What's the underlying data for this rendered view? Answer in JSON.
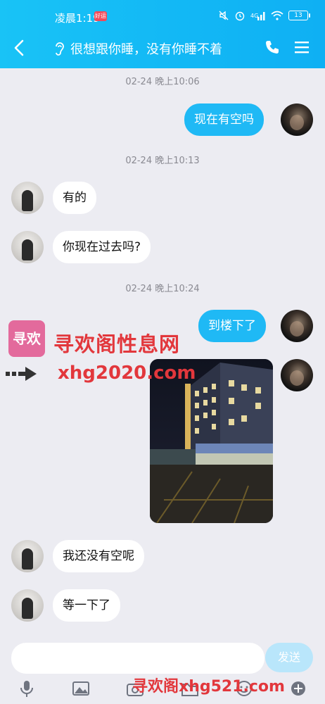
{
  "status_bar": {
    "time": "凌晨1:19",
    "badge": "好运",
    "battery": "13"
  },
  "header": {
    "title": "很想跟你睡，没有你睡不着"
  },
  "messages": [
    {
      "kind": "timestamp",
      "text": "02-24 晚上10:06"
    },
    {
      "kind": "message",
      "from": "me",
      "text": "现在有空吗"
    },
    {
      "kind": "timestamp",
      "text": "02-24 晚上10:13"
    },
    {
      "kind": "message",
      "from": "her",
      "text": "有的"
    },
    {
      "kind": "message",
      "from": "her",
      "text": "你现在过去吗?"
    },
    {
      "kind": "timestamp",
      "text": "02-24 晚上10:24"
    },
    {
      "kind": "message",
      "from": "me",
      "text": "到楼下了"
    },
    {
      "kind": "image",
      "from": "me"
    },
    {
      "kind": "message",
      "from": "her",
      "text": "我还没有空呢"
    },
    {
      "kind": "message",
      "from": "her",
      "text": "等一下了"
    }
  ],
  "watermark": {
    "logo_text": "寻欢",
    "site_name": "寻欢阁性息网",
    "url": "xhg2020.com",
    "bottom": "寻欢阁xhg521.com"
  },
  "composer": {
    "input_value": "",
    "send_label": "发送"
  },
  "toolbar": {
    "icons": [
      "microphone-icon",
      "image-icon",
      "camera-icon",
      "folder-icon",
      "emoji-icon",
      "plus-icon"
    ]
  },
  "colors": {
    "header": "#12b7f5",
    "outgoing_bubble": "#1fb9f5",
    "incoming_bubble": "#ffffff",
    "background": "#ececf2",
    "watermark": "#e2373c"
  }
}
